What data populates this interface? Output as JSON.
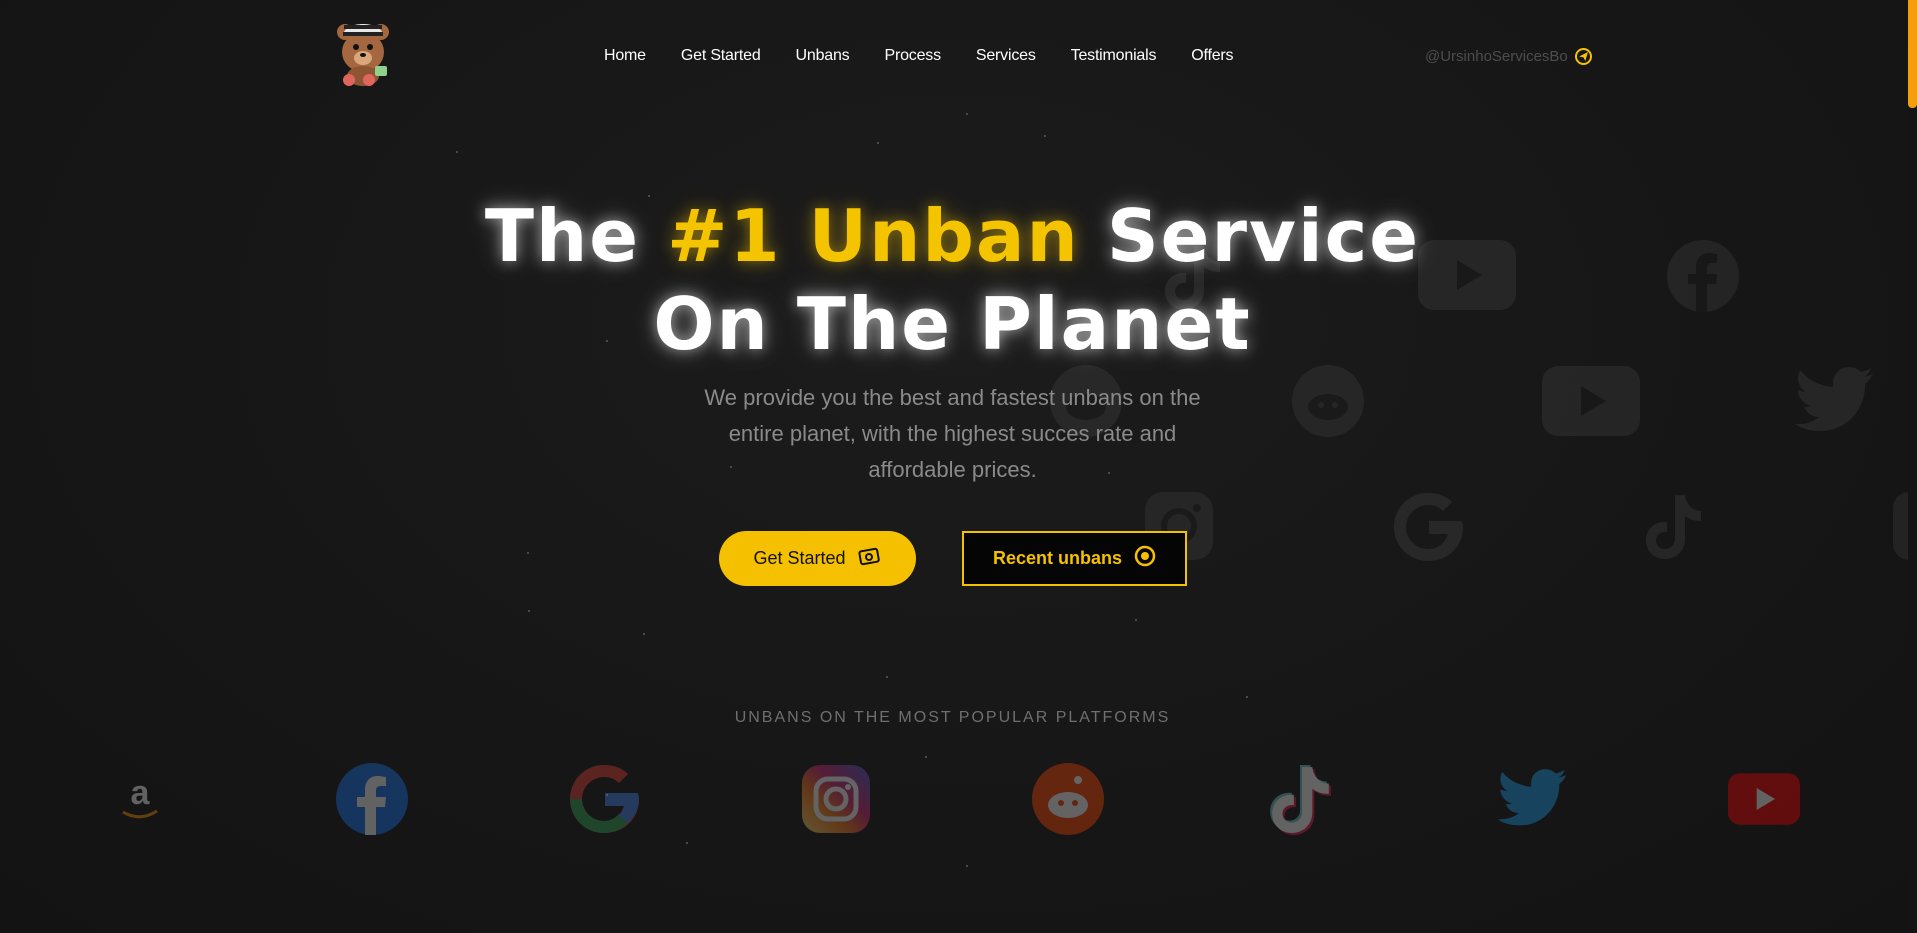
{
  "nav": {
    "logo": "teddy-bear-logo",
    "links": [
      "Home",
      "Get Started",
      "Unbans",
      "Process",
      "Services",
      "Testimonials",
      "Offers"
    ],
    "handle": "@UrsinhoServicesBo",
    "handle_icon": "telegram-icon"
  },
  "hero": {
    "title_part1": "The ",
    "title_accent": "#1 Unban",
    "title_part2": " Service",
    "title_line2": "On The Planet",
    "subtitle_lines": [
      "We provide you the best and fastest unbans on the",
      "entire planet, with the highest succes rate and",
      "affordable prices."
    ],
    "primary_button": "Get Started",
    "primary_button_icon": "money-icon",
    "secondary_button": "Recent unbans",
    "secondary_button_icon": "target-icon"
  },
  "platforms": {
    "heading": "UNBANS ON THE MOST POPULAR PLATFORMS",
    "items": [
      "amazon-icon",
      "facebook-icon",
      "google-icon",
      "instagram-icon",
      "reddit-icon",
      "tiktok-icon",
      "twitter-icon",
      "youtube-icon"
    ]
  },
  "colors": {
    "accent": "#f5c000",
    "background": "#171717",
    "scroll_thumb": "#f59e0b"
  }
}
